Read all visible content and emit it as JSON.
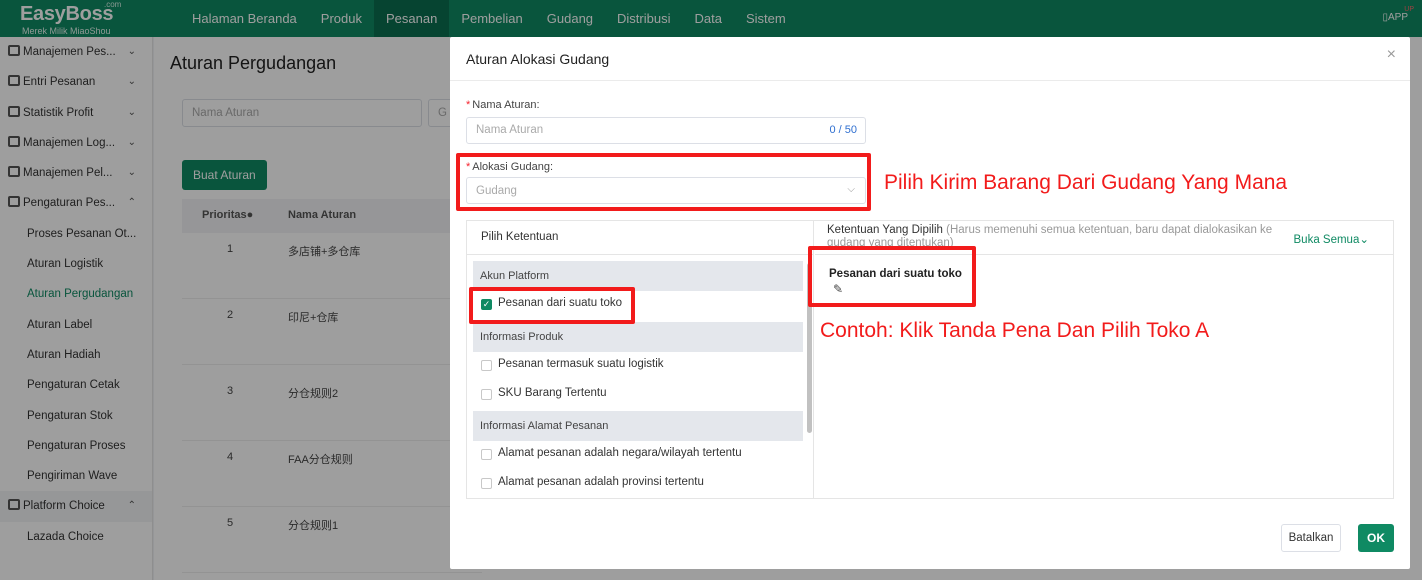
{
  "logo": {
    "com": ".com",
    "name": "EasyBoss",
    "sub": "Merek Milik MiaoShou"
  },
  "nav": [
    "Halaman Beranda",
    "Produk",
    "Pesanan",
    "Pembelian",
    "Gudang",
    "Distribusi",
    "Data",
    "Sistem"
  ],
  "app_label": "APP",
  "app_dot": "UP",
  "sidebar": {
    "groups_top": [
      {
        "label": "Manajemen Pes...",
        "chev": "⌄"
      },
      {
        "label": "Entri Pesanan",
        "chev": "⌄"
      },
      {
        "label": "Statistik Profit",
        "chev": "⌄"
      },
      {
        "label": "Manajemen Log...",
        "chev": "⌄"
      },
      {
        "label": "Manajemen Pel...",
        "chev": "⌄"
      },
      {
        "label": "Pengaturan Pes...",
        "chev": "⌃"
      }
    ],
    "subs": [
      "Proses Pesanan Ot...",
      "Aturan Logistik",
      "Aturan Pergudangan",
      "Aturan Label",
      "Aturan Hadiah",
      "Pengaturan Cetak",
      "Pengaturan Stok",
      "Pengaturan Proses",
      "Pengiriman Wave"
    ],
    "group_bottom": {
      "label": "Platform Choice",
      "chev": "⌃"
    },
    "sub_bottom": "Lazada Choice"
  },
  "page": {
    "title": "Aturan Pergudangan",
    "search_placeholder": "Nama Aturan",
    "search2_placeholder": "G",
    "create_button": "Buat Aturan",
    "col_priority": "Prioritas",
    "col_name": "Nama Aturan",
    "rows": [
      {
        "priority": "1",
        "name": "多店铺+多仓库"
      },
      {
        "priority": "2",
        "name": "印尼+仓库"
      },
      {
        "priority": "3",
        "name": "分仓规则2"
      },
      {
        "priority": "4",
        "name": "FAA分仓规则"
      },
      {
        "priority": "5",
        "name": "分仓规则1"
      }
    ]
  },
  "modal": {
    "title": "Aturan Alokasi Gudang",
    "close": "×",
    "name_label": "Nama Aturan:",
    "name_placeholder": "Nama Aturan",
    "name_count": "0 / 50",
    "warehouse_label": "Alokasi Gudang:",
    "warehouse_placeholder": "Gudang",
    "left_header": "Pilih Ketentuan",
    "categories": [
      {
        "title": "Akun Platform",
        "options": [
          {
            "label": "Pesanan dari suatu toko",
            "checked": true
          }
        ]
      },
      {
        "title": "Informasi Produk",
        "options": [
          {
            "label": "Pesanan termasuk suatu logistik",
            "checked": false
          },
          {
            "label": "SKU Barang Tertentu",
            "checked": false
          }
        ]
      },
      {
        "title": "Informasi Alamat Pesanan",
        "options": [
          {
            "label": "Alamat pesanan adalah negara/wilayah tertentu",
            "checked": false
          },
          {
            "label": "Alamat pesanan adalah provinsi tertentu",
            "checked": false
          }
        ]
      }
    ],
    "right_title": "Ketentuan Yang Dipilih",
    "right_note": "(Harus memenuhi semua ketentuan, baru dapat dialokasikan ke gudang yang ditentukan)",
    "open_all": "Buka Semua",
    "selected_condition": "Pesanan dari suatu toko",
    "cancel": "Batalkan",
    "ok": "OK"
  },
  "annotations": {
    "warehouse_hint": "Pilih Kirim Barang Dari Gudang Yang Mana",
    "example_hint": "Contoh: Klik Tanda Pena Dan Pilih Toko A"
  },
  "colors": {
    "brand": "#0f8a63",
    "annotation": "#f21b1b",
    "required": "#f5222d",
    "counter": "#2f6fd0"
  }
}
